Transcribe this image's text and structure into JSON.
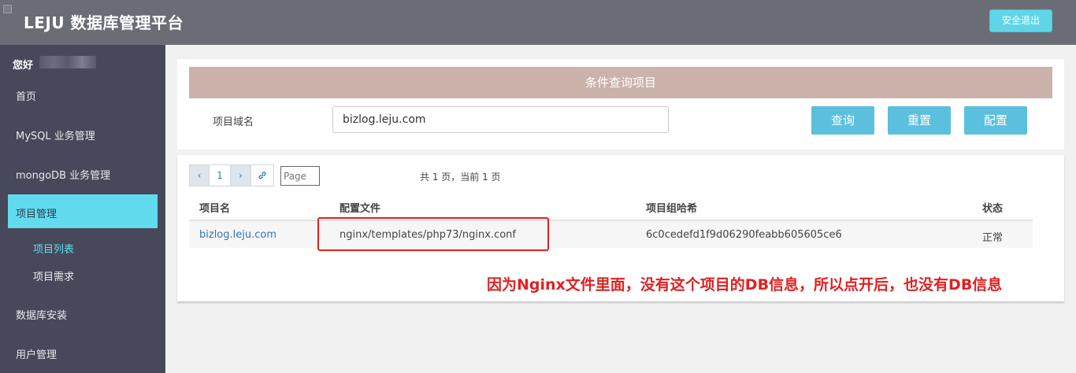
{
  "header": {
    "brand": "LEJU 数据库管理平台",
    "logout_label": "安全退出"
  },
  "sidebar": {
    "greeting": "您好",
    "items": [
      {
        "label": "首页"
      },
      {
        "label": "MySQL 业务管理"
      },
      {
        "label": "mongoDB 业务管理"
      },
      {
        "label": "项目管理"
      },
      {
        "label": "数据库安装"
      },
      {
        "label": "用户管理"
      }
    ],
    "sub_items": [
      {
        "label": "项目列表"
      },
      {
        "label": "项目需求"
      }
    ]
  },
  "query_panel": {
    "title": "条件查询项目",
    "field_label": "项目域名",
    "field_value": "bizlog.leju.com",
    "buttons": {
      "search": "查询",
      "reset": "重置",
      "config": "配置"
    }
  },
  "results": {
    "pager": {
      "prev": "‹",
      "current": "1",
      "next": "›",
      "link_icon": "link-icon",
      "page_placeholder": "Page",
      "info": "共 1 页，当前 1 页"
    },
    "columns": [
      "项目名",
      "配置文件",
      "项目组哈希",
      "状态"
    ],
    "rows": [
      [
        "bizlog.leju.com",
        "nginx/templates/php73/nginx.conf",
        "6c0cedefd1f9d06290feabb605605ce6",
        "正常"
      ]
    ]
  },
  "annotation": "因为Nginx文件里面，没有这个项目的DB信息，所以点开后，也没有DB信息",
  "colors": {
    "topbar": "#6b6d76",
    "sidebar": "#47495a",
    "accent": "#62dbef",
    "panel_head": "#cbb2aa",
    "button": "#5bc0de",
    "annotation": "#e02020"
  }
}
